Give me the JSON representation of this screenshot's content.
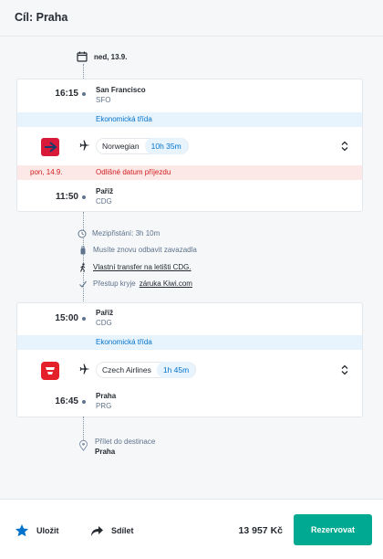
{
  "header": {
    "title": "Cíl: Praha"
  },
  "date_label": "ned, 13.9.",
  "segment1": {
    "departure": {
      "time": "16:15",
      "city": "San Francisco",
      "code": "SFO"
    },
    "class": "Ekonomická třída",
    "airline": {
      "name": "Norwegian",
      "duration": "10h 35m",
      "logo_color": "#d81939"
    },
    "warning": {
      "date": "pon, 14.9.",
      "text": "Odlišné datum příjezdu"
    },
    "arrival": {
      "time": "11:50",
      "city": "Paříž",
      "code": "CDG"
    }
  },
  "layover": {
    "stopover": "Mezipřistání: 3h 10m",
    "bags": "Musíte znovu odbavit zavazadla",
    "transfer": "Vlastní transfer na letišti CDG.",
    "guarantee_prefix": "Přestup kryje",
    "guarantee_link": "záruka Kiwi.com"
  },
  "segment2": {
    "departure": {
      "time": "15:00",
      "city": "Paříž",
      "code": "CDG"
    },
    "class": "Ekonomická třída",
    "airline": {
      "name": "Czech Airlines",
      "duration": "1h 45m",
      "logo_color": "#e4212b"
    },
    "arrival": {
      "time": "16:45",
      "city": "Praha",
      "code": "PRG"
    }
  },
  "destination": {
    "label": "Přílet do destinace",
    "city": "Praha"
  },
  "footer": {
    "save": "Uložit",
    "share": "Sdílet",
    "price": "13 957 Kč",
    "book": "Rezervovat"
  },
  "colors": {
    "accent": "#00a991",
    "info_blue": "#0172cb",
    "warning_red": "#d21c1c",
    "star": "#0172cb"
  }
}
